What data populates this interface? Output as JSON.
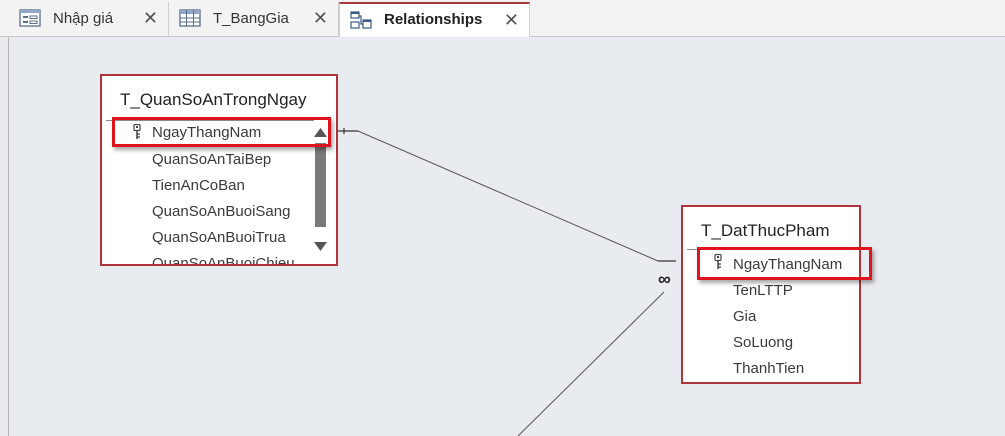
{
  "tabs": [
    {
      "label": "Nhập giá",
      "icon": "form-icon",
      "active": false
    },
    {
      "label": "T_BangGia",
      "icon": "table-icon",
      "active": false
    },
    {
      "label": "Relationships",
      "icon": "relationships-icon",
      "active": true
    }
  ],
  "close_glyph": "✕",
  "tables": {
    "quanso": {
      "title": "T_QuanSoAnTrongNgay",
      "fields": [
        "NgayThangNam",
        "QuanSoAnTaiBep",
        "TienAnCoBan",
        "QuanSoAnBuoiSang",
        "QuanSoAnBuoiTrua",
        "QuanSoAnBuoiChieu"
      ]
    },
    "datthuc": {
      "title": "T_DatThucPham",
      "fields": [
        "NgayThangNam",
        "TenLTTP",
        "Gia",
        "SoLuong",
        "ThanhTien"
      ]
    }
  },
  "relationship": {
    "many_symbol": "∞"
  },
  "colors": {
    "highlight": "#e0141e",
    "table_border": "#b0343c",
    "active_tab_accent": "#a4373a"
  }
}
